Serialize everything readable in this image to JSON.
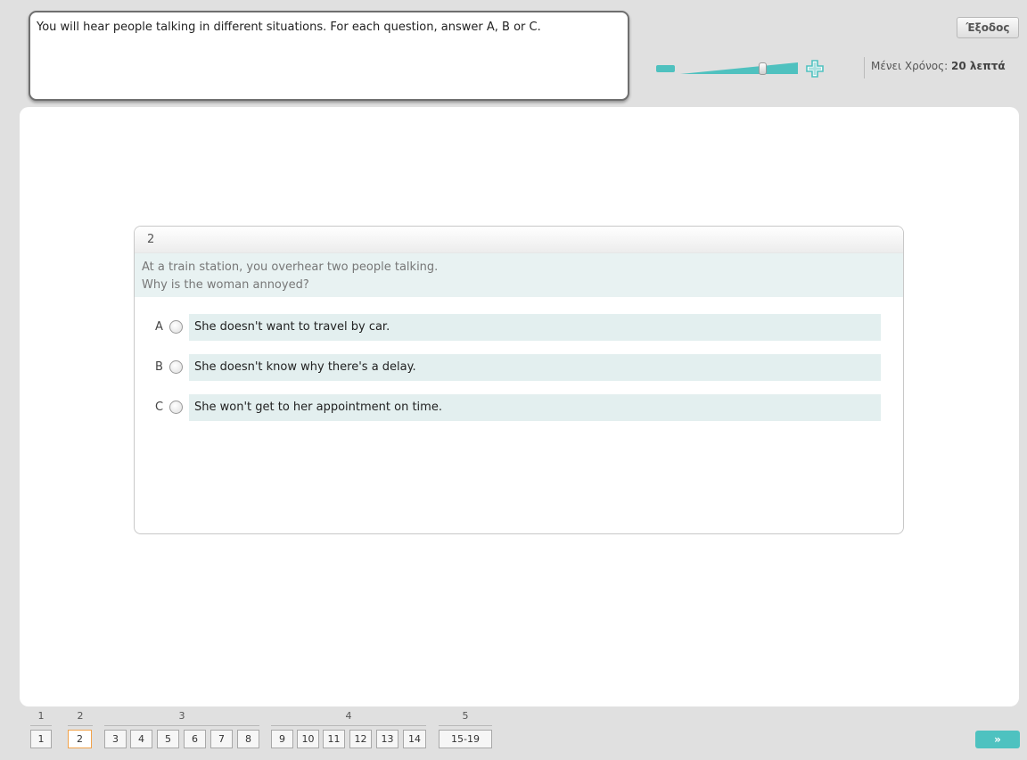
{
  "instruction": "You will hear people talking in different situations. For each question, answer A, B or C.",
  "header": {
    "exit_label": "Έξοδος",
    "timer_label": "Μένει Χρόνος:",
    "timer_value": "20 λεπτά"
  },
  "colors": {
    "accent": "#4fc1bf",
    "active_border": "#f0a24a",
    "option_bg": "#e3efef"
  },
  "question": {
    "number": "2",
    "prompt_line1": "At a train station, you overhear two people talking.",
    "prompt_line2": "Why is the woman annoyed?",
    "options": [
      {
        "letter": "A",
        "text": "She doesn't want to travel by car."
      },
      {
        "letter": "B",
        "text": "She doesn't know why there's a delay."
      },
      {
        "letter": "C",
        "text": "She won't get to her appointment on time."
      }
    ]
  },
  "nav": {
    "groups": [
      {
        "label": "1",
        "questions": [
          "1"
        ]
      },
      {
        "label": "2",
        "questions": [
          "2"
        ]
      },
      {
        "label": "3",
        "questions": [
          "3",
          "4",
          "5",
          "6",
          "7",
          "8"
        ]
      },
      {
        "label": "4",
        "questions": [
          "9",
          "10",
          "11",
          "12",
          "13",
          "14"
        ]
      },
      {
        "label": "5",
        "questions": [
          "15-19"
        ]
      }
    ],
    "active_question": "2",
    "next_label": "»"
  }
}
